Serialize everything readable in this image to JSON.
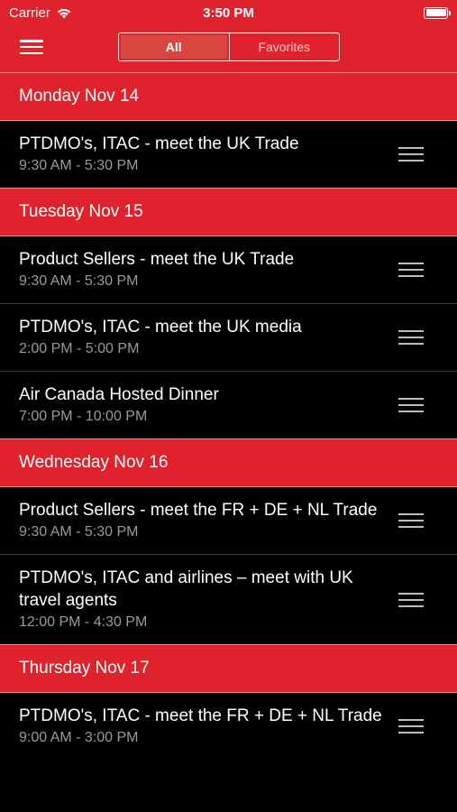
{
  "status_bar": {
    "carrier": "Carrier",
    "time": "3:50 PM"
  },
  "nav": {
    "tabs": [
      {
        "label": "All",
        "active": true
      },
      {
        "label": "Favorites",
        "active": false
      }
    ]
  },
  "sections": [
    {
      "day": "Monday Nov 14",
      "events": [
        {
          "title": "PTDMO's, ITAC - meet the UK Trade",
          "time": "9:30 AM - 5:30 PM"
        }
      ]
    },
    {
      "day": "Tuesday Nov 15",
      "events": [
        {
          "title": "Product Sellers - meet the UK Trade",
          "time": "9:30 AM - 5:30 PM"
        },
        {
          "title": "PTDMO's, ITAC - meet the UK media",
          "time": "2:00 PM - 5:00 PM"
        },
        {
          "title": "Air Canada Hosted Dinner",
          "time": "7:00 PM - 10:00 PM"
        }
      ]
    },
    {
      "day": "Wednesday Nov 16",
      "events": [
        {
          "title": "Product Sellers - meet the FR + DE + NL Trade",
          "time": "9:30 AM - 5:30 PM"
        },
        {
          "title": "PTDMO's, ITAC and airlines – meet with UK travel agents",
          "time": "12:00 PM - 4:30 PM"
        }
      ]
    },
    {
      "day": "Thursday Nov 17",
      "events": [
        {
          "title": "PTDMO's, ITAC - meet the FR + DE + NL Trade",
          "time": "9:00 AM - 3:00 PM"
        }
      ]
    }
  ],
  "colors": {
    "accent": "#e0222c",
    "background": "#000000",
    "secondary_text": "#9a9a9a"
  }
}
